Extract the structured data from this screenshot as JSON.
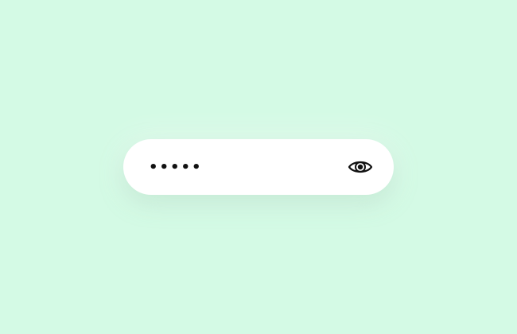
{
  "password_field": {
    "value": "•••••",
    "masked": true,
    "toggle_icon": "eye-icon"
  },
  "colors": {
    "background": "#d4fae5",
    "field": "#ffffff",
    "text": "#111111"
  }
}
